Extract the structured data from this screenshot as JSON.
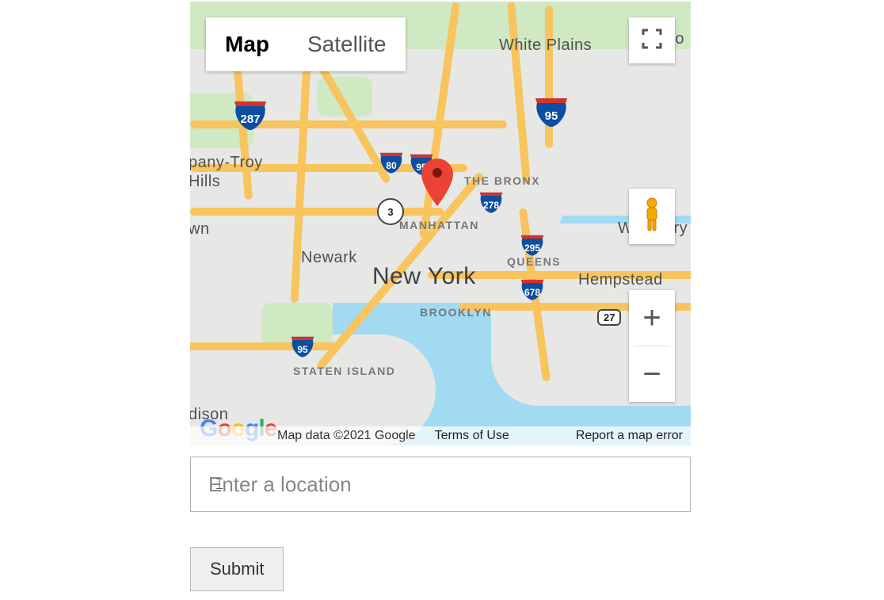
{
  "map": {
    "type_selector": {
      "map_label": "Map",
      "satellite_label": "Satellite",
      "active": "map"
    },
    "marker": {
      "label": "selected-location"
    },
    "places": {
      "white_plains": "White Plains",
      "pany_troy": "pany-Troy",
      "hills": "Hills",
      "the_bronx": "THE BRONX",
      "manhattan": "MANHATTAN",
      "newark": "Newark",
      "new_york": "New York",
      "queens": "QUEENS",
      "hempstead": "Hempstead",
      "westbury": "Westbury",
      "brooklyn": "BROOKLYN",
      "staten_island": "STATEN ISLAND",
      "dison": "dison",
      "wn": "wn",
      "fo": "fo"
    },
    "shields": {
      "i287": "287",
      "i95_top": "95",
      "i80": "80",
      "i95_mid": "95",
      "i278": "278",
      "i295": "295",
      "i678": "678",
      "i95_bottom": "95",
      "r3": "3",
      "r27": "27"
    },
    "footer": {
      "logo": "Google",
      "data": "Map data ©2021 Google",
      "terms": "Terms of Use",
      "report": "Report a map error"
    },
    "controls": {
      "fullscreen": "fullscreen",
      "pegman": "street-view-pegman",
      "zoom_in": "+",
      "zoom_out": "−"
    }
  },
  "form": {
    "location_placeholder": "Enter a location",
    "location_value": "",
    "submit_label": "Submit"
  }
}
